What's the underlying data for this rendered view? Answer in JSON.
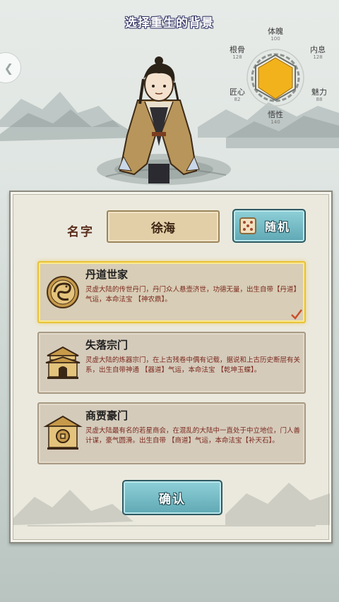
{
  "header": {
    "title": "选择重生的背景"
  },
  "stats": {
    "tipo": {
      "name": "体魄",
      "value": "100"
    },
    "neixi": {
      "name": "内息",
      "value": "128"
    },
    "meili": {
      "name": "魅力",
      "value": "88"
    },
    "wuxing": {
      "name": "悟性",
      "value": "140"
    },
    "jiangxin": {
      "name": "匠心",
      "value": "82"
    },
    "gengu": {
      "name": "根骨",
      "value": "128"
    },
    "accent_color": "#f2b21c"
  },
  "name_row": {
    "label": "名字",
    "value": "徐海",
    "random_label": "随机"
  },
  "options": [
    {
      "title": "丹道世家",
      "desc": "灵虚大陆的传世丹门，丹门众人悬壶济世，功德无量，出生自带【丹道】气运，本命法宝 【神农鼎】。",
      "icon": "dragon-emblem-icon",
      "selected": true
    },
    {
      "title": "失落宗门",
      "desc": "灵虚大陆的炼器宗门，在上古残卷中偶有记载，据说和上古历史断层有关系，出生自带神通 【器道】气运，本命法宝 【乾坤玉蝶】。",
      "icon": "sect-gate-icon",
      "selected": false
    },
    {
      "title": "商贾豪门",
      "desc": "灵虚大陆最有名的若星商会，在混乱的大陆中一直处于中立地位，门人善计谋，豪气圆滑。出生自带 【商道】气运，本命法宝【补天石】。",
      "icon": "merchant-hall-icon",
      "selected": false
    }
  ],
  "confirm_label": "确认"
}
